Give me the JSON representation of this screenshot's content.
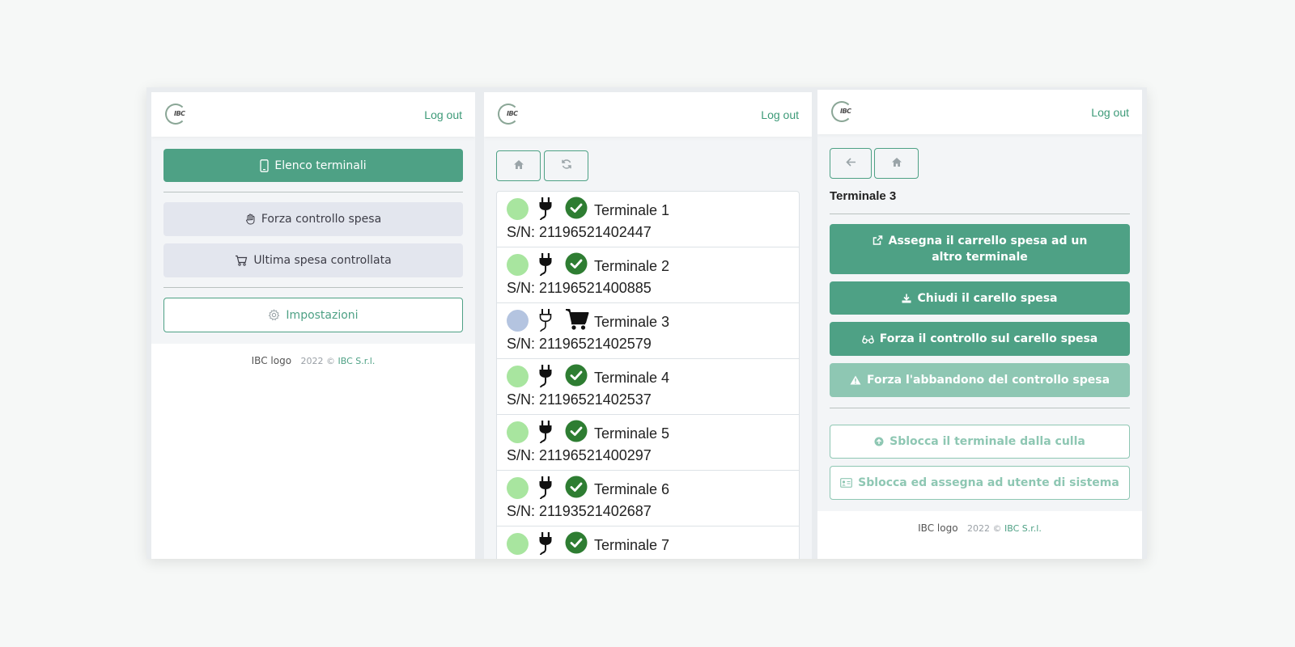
{
  "common": {
    "logo_text": "IBC",
    "logout": "Log out",
    "footer_broken_img": "IBC logo",
    "footer_year": "2022 ©",
    "footer_company": "IBC S.r.l."
  },
  "home": {
    "btn_terminals": "Elenco terminali",
    "btn_force_check": "Forza controllo spesa",
    "btn_last_check": "Ultima spesa controllata",
    "btn_settings": "Impostazioni"
  },
  "terminals": {
    "items": [
      {
        "name": "Terminale 1",
        "sn": "S/N: 21196521402447",
        "dot": "#a8e59f",
        "plug": "connected",
        "status": "ok"
      },
      {
        "name": "Terminale 2",
        "sn": "S/N: 21196521400885",
        "dot": "#a8e59f",
        "plug": "connected",
        "status": "ok"
      },
      {
        "name": "Terminale 3",
        "sn": "S/N: 21196521402579",
        "dot": "#b4c4e0",
        "plug": "disconnected",
        "status": "cart"
      },
      {
        "name": "Terminale 4",
        "sn": "S/N: 21196521402537",
        "dot": "#a8e59f",
        "plug": "connected",
        "status": "ok"
      },
      {
        "name": "Terminale 5",
        "sn": "S/N: 21196521400297",
        "dot": "#a8e59f",
        "plug": "connected",
        "status": "ok"
      },
      {
        "name": "Terminale 6",
        "sn": "S/N: 21193521402687",
        "dot": "#a8e59f",
        "plug": "connected",
        "status": "ok"
      },
      {
        "name": "Terminale 7",
        "sn": "",
        "dot": "#a8e59f",
        "plug": "connected",
        "status": "ok"
      }
    ]
  },
  "detail": {
    "title": "Terminale 3",
    "btn_assign": "Assegna il carrello spesa ad un altro terminale",
    "btn_close": "Chiudi il carello spesa",
    "btn_force_control": "Forza il controllo sul carello spesa",
    "btn_force_abandon": "Forza l'abbandono del controllo spesa",
    "btn_unlock_cradle": "Sblocca il terminale dalla culla",
    "btn_unlock_assign": "Sblocca ed assegna ad utente di sistema"
  },
  "colors": {
    "accent": "#4ea185",
    "accent_light": "#8ec7b3",
    "status_ok": "#2e7d32",
    "dot_online": "#a8e59f",
    "dot_offline": "#b4c4e0"
  }
}
